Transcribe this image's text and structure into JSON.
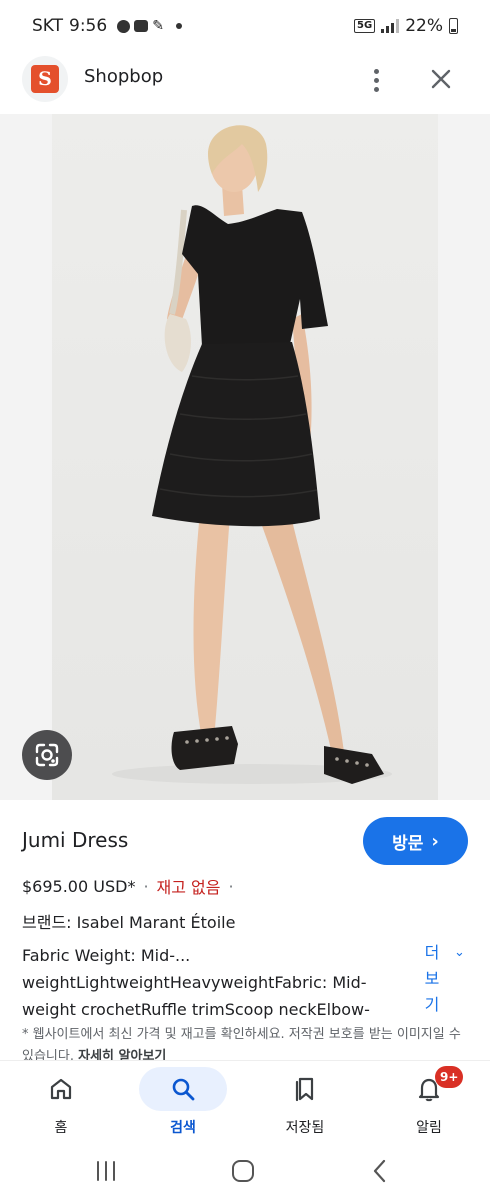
{
  "status_bar": {
    "carrier": "SKT",
    "time": "9:56",
    "network": "5G",
    "battery": "22%"
  },
  "header": {
    "logo_letter": "S",
    "site_name": "Shopbop",
    "logo_color": "#e4502c"
  },
  "product": {
    "title": "Jumi Dress",
    "visit_label": "방문",
    "price": "$695.00 USD*",
    "stock_status": "재고 없음",
    "brand": "브랜드: Isabel Marant Étoile",
    "description_lines": [
      "Fabric Weight: Mid-...",
      "weightLightweightHeavyweightFabric: Mid-",
      "weight crochetRuffle trimScoop neckElbow-"
    ],
    "more_label_col1": "더",
    "more_label_col2": "보",
    "more_label_col3": "기",
    "notice": "* 웹사이트에서 최신 가격 및 재고를 확인하세요. 저작권 보호를 받는 이미지일 수 있습니다.",
    "notice_link": "자세히 알아보기"
  },
  "bottom_nav": {
    "items": [
      {
        "label": "홈",
        "icon": "home-icon"
      },
      {
        "label": "검색",
        "icon": "search-icon"
      },
      {
        "label": "저장됨",
        "icon": "collections-icon"
      },
      {
        "label": "알림",
        "icon": "bell-icon"
      }
    ],
    "active": "검색",
    "notification_badge": "9+"
  },
  "colors": {
    "accent": "#1a73e8",
    "stock": "#c5221f",
    "badge": "#d93025"
  }
}
